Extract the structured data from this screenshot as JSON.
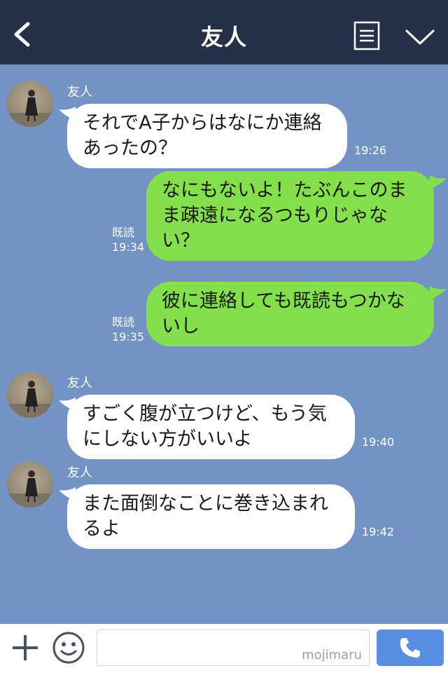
{
  "header": {
    "title": "友人"
  },
  "messages": [
    {
      "side": "in",
      "sender": "友人",
      "text": "それでA子からはなにか連絡あったの？",
      "time": "19:26"
    },
    {
      "side": "out",
      "read_label": "既読",
      "text": "なにもないよ！たぶんこのまま疎遠になるつもりじゃない？",
      "time": "19:34"
    },
    {
      "side": "out",
      "read_label": "既読",
      "text": "彼に連絡しても既読もつかないし",
      "time": "19:35"
    },
    {
      "side": "in",
      "sender": "友人",
      "text": "すごく腹が立つけど、もう気にしない方がいいよ",
      "time": "19:40"
    },
    {
      "side": "in",
      "sender": "友人",
      "text": "また面倒なことに巻き込まれるよ",
      "time": "19:42"
    }
  ],
  "footer": {
    "input_value": "",
    "watermark": "mojimaru"
  },
  "colors": {
    "header_bg": "#263048",
    "chat_bg": "#7293c4",
    "incoming_bubble": "#ffffff",
    "outgoing_bubble": "#83e04c",
    "call_button": "#5a8ee0"
  },
  "icons": [
    "back-arrow",
    "menu-list",
    "chevron-down",
    "plus",
    "smiley",
    "phone"
  ]
}
